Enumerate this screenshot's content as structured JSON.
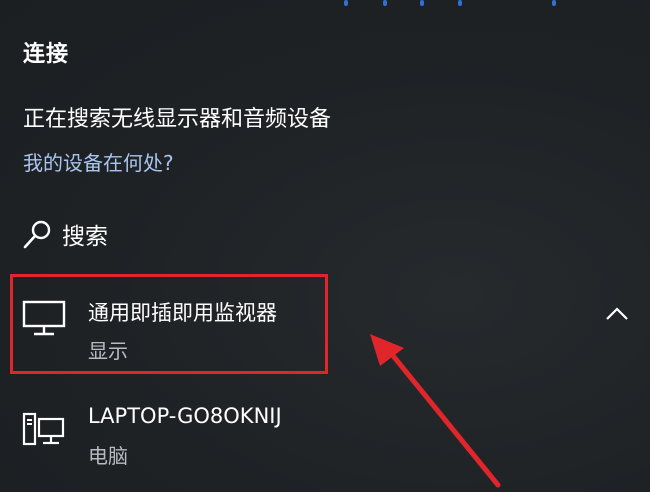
{
  "title": "连接",
  "status_text": "正在搜索无线显示器和音频设备",
  "help_link": "我的设备在何处?",
  "search": {
    "icon": "search-icon",
    "label": "搜索"
  },
  "devices": [
    {
      "icon": "monitor-icon",
      "name": "通用即插即用监视器",
      "type": "显示",
      "expanded": true
    },
    {
      "icon": "computer-icon",
      "name": "LAPTOP-GO8OKNIJ",
      "type": "电脑"
    }
  ],
  "colors": {
    "background": "#1f2326",
    "link": "#a9c5ee",
    "annotation": "#e0262b",
    "progress": "#2f6fd6"
  }
}
